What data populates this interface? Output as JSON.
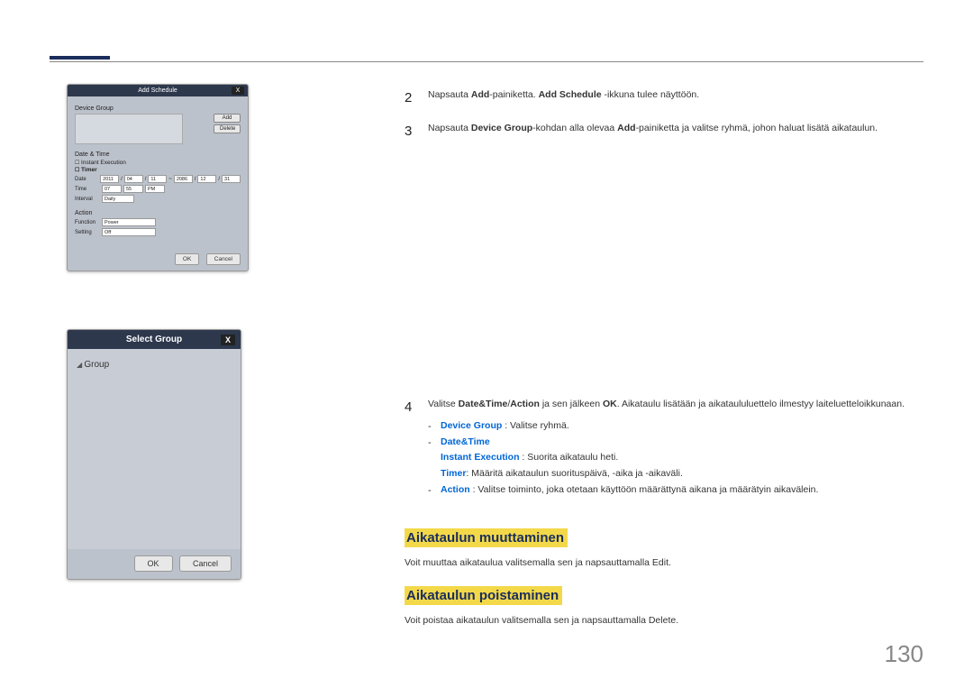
{
  "page_number": "130",
  "dialog_add": {
    "title": "Add Schedule",
    "close": "X",
    "device_group_label": "Device Group",
    "btn_add": "Add",
    "btn_delete": "Delete",
    "datetime_label": "Date & Time",
    "instant_exec": "Instant Execution",
    "timer_label": "Timer",
    "date_label": "Date",
    "date_y1": "2011",
    "date_m1": "04",
    "date_d1": "11",
    "date_y2": "2086",
    "date_m2": "12",
    "date_d2": "31",
    "time_label": "Time",
    "time_h": "07",
    "time_m": "55",
    "time_ampm": "PM",
    "interval_label": "Interval",
    "interval_val": "Daily",
    "action_label": "Action",
    "function_label": "Function",
    "function_val": "Power",
    "setting_label": "Setting",
    "setting_val": "Off",
    "ok": "OK",
    "cancel": "Cancel"
  },
  "dialog_select": {
    "title": "Select Group",
    "close": "X",
    "tree_root": "Group",
    "ok": "OK",
    "cancel": "Cancel"
  },
  "steps": {
    "s2": {
      "num": "2",
      "t1": "Napsauta ",
      "t2": "Add",
      "t3": "-painiketta. ",
      "t4": "Add Schedule",
      "t5": " -ikkuna tulee näyttöön."
    },
    "s3": {
      "num": "3",
      "t1": "Napsauta ",
      "t2": "Device Group",
      "t3": "-kohdan alla olevaa ",
      "t4": "Add",
      "t5": "-painiketta ja valitse ryhmä, johon haluat lisätä aikataulun."
    },
    "s4": {
      "num": "4",
      "t1": "Valitse ",
      "t2": "Date&Time",
      "t3": "/",
      "t4": "Action",
      "t5": " ja sen jälkeen ",
      "t6": "OK",
      "t7": ". Aikataulu lisätään ja aikataululuettelo ilmestyy laiteluetteloikkunaan.",
      "li1a": "Device Group",
      "li1b": " : Valitse ryhmä.",
      "li2": "Date&Time",
      "li3a": "Instant Execution",
      "li3b": " : Suorita aikataulu heti.",
      "li4a": "Timer",
      "li4b": ": Määritä aikataulun suorituspäivä, -aika ja -aikaväli.",
      "li5a": "Action",
      "li5b": " : Valitse toiminto, joka otetaan käyttöön määrättynä aikana ja määrätyin aikavälein."
    }
  },
  "sections": {
    "h_modify": "Aikataulun muuttaminen",
    "p_modify_a": "Voit muuttaa aikataulua valitsemalla sen ja napsauttamalla ",
    "p_modify_b": "Edit",
    "p_modify_c": ".",
    "h_delete": "Aikataulun poistaminen",
    "p_delete_a": "Voit poistaa aikataulun valitsemalla sen ja napsauttamalla ",
    "p_delete_b": "Delete",
    "p_delete_c": "."
  }
}
